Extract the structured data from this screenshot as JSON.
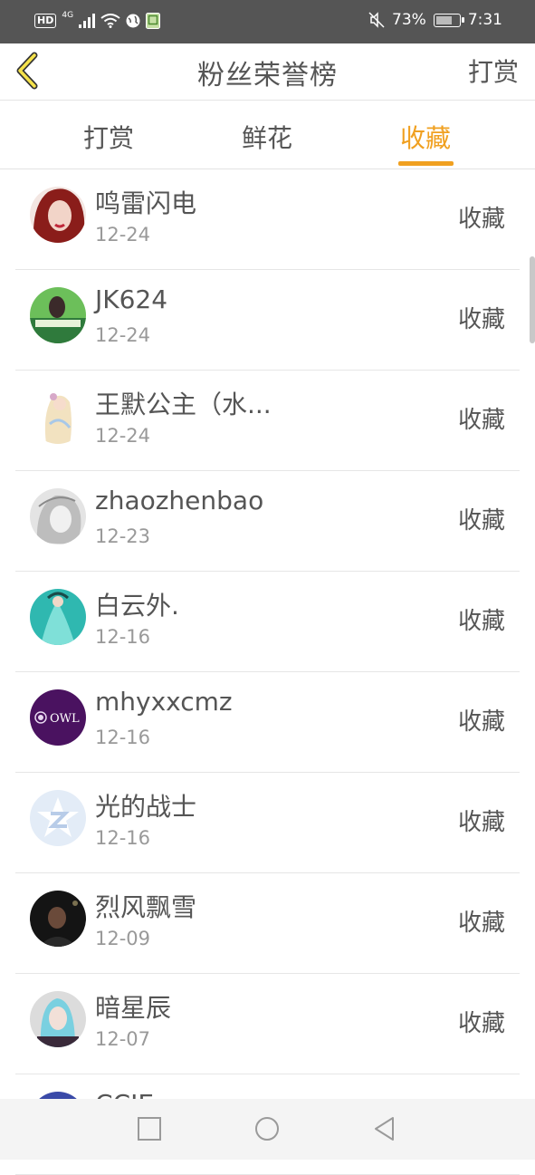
{
  "status_bar": {
    "network": "HD",
    "generation": "4G",
    "battery": "73%",
    "time": "7:31"
  },
  "header": {
    "title": "粉丝荣誉榜",
    "action_label": "打赏"
  },
  "tabs": [
    {
      "label": "打赏",
      "active": false
    },
    {
      "label": "鲜花",
      "active": false
    },
    {
      "label": "收藏",
      "active": true
    }
  ],
  "accent_color": "#f0a020",
  "fans": [
    {
      "name": "鸣雷闪电",
      "date": "12-24",
      "action": "收藏"
    },
    {
      "name": "JK624",
      "date": "12-24",
      "action": "收藏"
    },
    {
      "name": "王默公主（水...",
      "date": "12-24",
      "action": "收藏"
    },
    {
      "name": "zhaozhenbao",
      "date": "12-23",
      "action": "收藏"
    },
    {
      "name": "白云外.",
      "date": "12-16",
      "action": "收藏"
    },
    {
      "name": "mhyxxcmz",
      "date": "12-16",
      "action": "收藏"
    },
    {
      "name": "光的战士",
      "date": "12-16",
      "action": "收藏"
    },
    {
      "name": "烈风飘雪",
      "date": "12-09",
      "action": "收藏"
    },
    {
      "name": "暗星辰",
      "date": "12-07",
      "action": "收藏"
    },
    {
      "name": "CCIE",
      "date": "",
      "action": ""
    }
  ]
}
